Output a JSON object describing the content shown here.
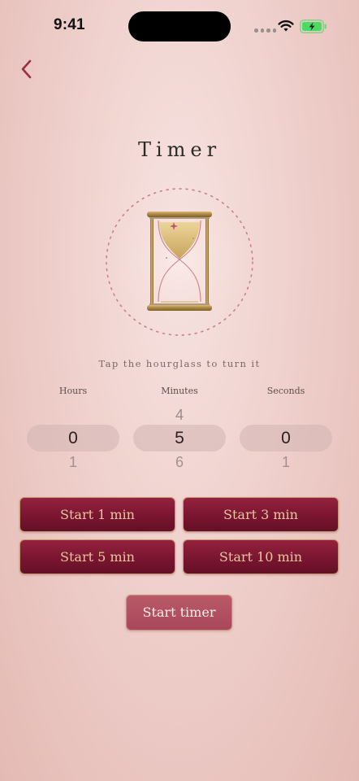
{
  "status_bar": {
    "time": "9:41"
  },
  "navigation": {
    "back_icon": "chevron-left-icon"
  },
  "header": {
    "title": "Timer"
  },
  "hourglass": {
    "icon": "hourglass-icon",
    "hint": "Tap the hourglass to turn it"
  },
  "picker": {
    "hours": {
      "label": "Hours",
      "above": "",
      "selected": "0",
      "below": "1"
    },
    "minutes": {
      "label": "Minutes",
      "above": "4",
      "selected": "5",
      "below": "6"
    },
    "seconds": {
      "label": "Seconds",
      "above": "",
      "selected": "0",
      "below": "1"
    }
  },
  "presets": [
    {
      "label": "Start 1 min"
    },
    {
      "label": "Start 3 min"
    },
    {
      "label": "Start 5 min"
    },
    {
      "label": "Start 10 min"
    }
  ],
  "start_label": "Start timer",
  "colors": {
    "accent": "#7a1530",
    "gold": "#c9a25a",
    "background": "#efd0cc",
    "start_button": "#a8475a",
    "battery": "#4cd964"
  }
}
